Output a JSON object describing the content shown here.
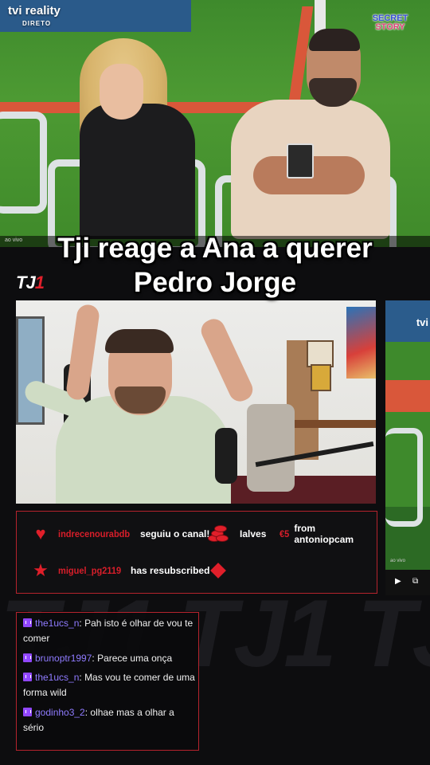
{
  "broadcast": {
    "channel_logo": "tvi reality",
    "channel_sub": "DIRETO",
    "show_logo_line1": "SECRET",
    "show_logo_line2": "STORY",
    "strip_label": "ao vivo"
  },
  "caption": {
    "line1": "Tji reage a Ana a querer",
    "line2": "Pedro Jorge"
  },
  "stream": {
    "logo_main": "TJ",
    "logo_accent": "1",
    "watermark": "TJ1 TJ1 TJ1"
  },
  "side_video": {
    "logo": "tvi",
    "label": "ao vivo",
    "play_icon": "▶",
    "pip_icon": "⧉"
  },
  "alerts": [
    {
      "icon": "heart-icon",
      "name": "indrecenourabdb",
      "text": "seguiu o canal!"
    },
    {
      "icon": "coins-icon",
      "name": "",
      "text": "Ialves"
    },
    {
      "icon": "",
      "name": "€5",
      "text": "from antoniopcam"
    },
    {
      "icon": "star-icon",
      "name": "miguel_pg2119",
      "text": "has resubscribed"
    },
    {
      "icon": "diamond-icon",
      "name": "",
      "text": ""
    }
  ],
  "chat": [
    {
      "user": "the1ucs_n",
      "text": "Pah isto é olhar de vou te comer"
    },
    {
      "user": "brunoptr1997",
      "text": "Parece uma onça"
    },
    {
      "user": "the1ucs_n",
      "text": "Mas vou te comer de uma forma wild"
    },
    {
      "user": "godinho3_2",
      "text": "olhae mas a olhar a sério"
    }
  ],
  "colors": {
    "accent_red": "#e01f2a",
    "chat_user": "#8f7bff",
    "twitch_purple": "#9147ff"
  }
}
